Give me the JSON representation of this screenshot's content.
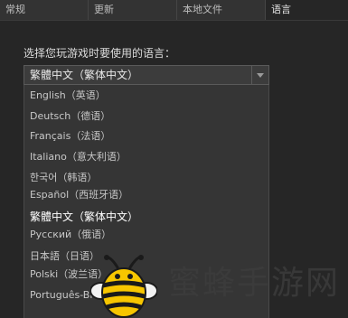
{
  "tabs": [
    {
      "label": "常规",
      "active": false
    },
    {
      "label": "更新",
      "active": false
    },
    {
      "label": "本地文件",
      "active": false
    },
    {
      "label": "语言",
      "active": true
    }
  ],
  "language": {
    "prompt": "选择您玩游戏时要使用的语言：",
    "selected_value": "繁體中文（繁体中文）",
    "options": [
      "English（英语）",
      "Deutsch（德语）",
      "Français（法语）",
      "Italiano（意大利语）",
      "한국어（韩语）",
      "Español（西班牙语）",
      "繁體中文（繁体中文）",
      "Русский（俄语）",
      "日本語（日语）",
      "Polski（波兰语）",
      "Português-Bras...巴西)"
    ]
  },
  "watermark": {
    "text": "蜜蜂手游网"
  },
  "colors": {
    "background": "#262626",
    "dropdown": "#353535",
    "select": "#3c3c3c",
    "text": "#c8c8c8"
  }
}
